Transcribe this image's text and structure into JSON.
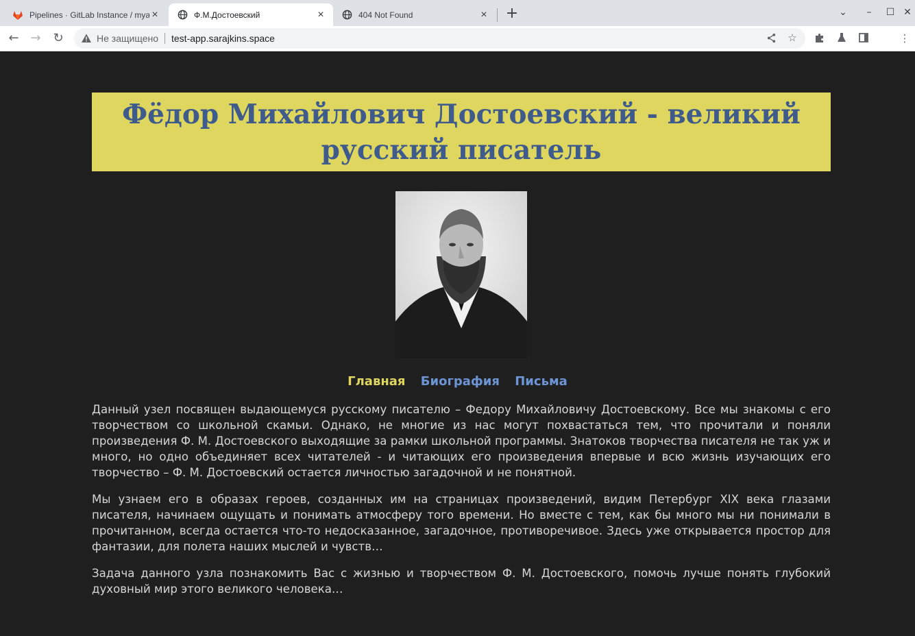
{
  "browser": {
    "tabs": [
      {
        "title": "Pipelines · GitLab Instance / myap",
        "favicon": "gitlab-icon",
        "active": false
      },
      {
        "title": "Ф.М.Достоевский",
        "favicon": "globe-icon",
        "active": true
      },
      {
        "title": "404 Not Found",
        "favicon": "globe-icon",
        "active": false
      }
    ],
    "address_bar": {
      "security_label": "Не защищено",
      "url": "test-app.sarajkins.space"
    }
  },
  "page": {
    "heading": "Фёдор Михайлович Достоевский - великий русский писатель",
    "portrait_subject": "portrait-image",
    "nav": [
      {
        "label": "Главная",
        "current": true
      },
      {
        "label": "Биография",
        "current": false
      },
      {
        "label": "Письма",
        "current": false
      }
    ],
    "paragraphs": [
      "Данный узел посвящен выдающемуся русскому писателю – Федору Михайловичу Достоевскому. Все мы знакомы с его творчеством со школьной скамьи. Однако, не многие из нас могут похвастаться тем, что прочитали и поняли произведения Ф. М. Достоевского выходящие за рамки школьной программы. Знатоков творчества писателя не так уж и много, но одно объединяет всех читателей - и читающих его произведения впервые и всю жизнь изучающих его творчество – Ф. М. Достоевский остается личностью загадочной и не понятной.",
      "Мы узнаем его в образах героев, созданных им на страницах произведений, видим Петербург XIX века глазами писателя, начинаем ощущать и понимать атмосферу того времени. Но вместе с тем, как бы много мы ни понимали в прочитанном, всегда остается что-то недосказанное, загадочное, противоречивое. Здесь уже открывается простор для фантазии, для полета наших мыслей и чувств…",
      "Задача данного узла познакомить Вас с жизнью и творчеством Ф. М. Достоевского, помочь лучше понять глубокий духовный мир этого великого человека…"
    ]
  },
  "colors": {
    "page_bg": "#1f1f1f",
    "heading_bg": "#ded65e",
    "heading_text": "#3f5b8c",
    "nav_current": "#ded65e",
    "nav_link": "#6d94d4",
    "body_text": "#d6d6d6"
  }
}
